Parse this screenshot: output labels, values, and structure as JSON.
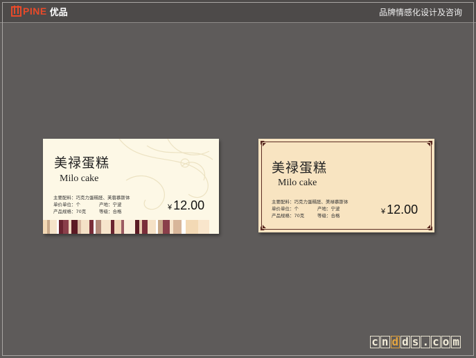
{
  "header": {
    "logo_text": "PINE",
    "logo_cn": "优品",
    "tagline": "品牌情感化设计及咨询"
  },
  "cards": [
    {
      "title_cn": "美禄蛋糕",
      "title_en": "Milo cake",
      "rows": [
        {
          "a": "主要配料：巧克力蛋糕胚、芙蓉慕斯体",
          "b": ""
        },
        {
          "a": "单价单位：个",
          "b": "产地：宁波"
        },
        {
          "a": "产品规格：70克",
          "b": "等级：合格"
        }
      ],
      "currency": "¥",
      "price": "12.00"
    },
    {
      "title_cn": "美禄蛋糕",
      "title_en": "Milo cake",
      "rows": [
        {
          "a": "主要配料：巧克力蛋糕胚、美禄慕斯体",
          "b": ""
        },
        {
          "a": "单价单位：个",
          "b": "产地：宁波"
        },
        {
          "a": "产品规格：70克",
          "b": "等级：合格"
        }
      ],
      "currency": "¥",
      "price": "12.00"
    }
  ],
  "watermark": {
    "letters": [
      "c",
      "n",
      "d",
      "d",
      "s",
      ".",
      "c",
      "o",
      "m"
    ]
  },
  "colors": {
    "background": "#5e5b5a",
    "logo": "#e84a2a",
    "card1": "#fdf8e6",
    "card2": "#f8e4c1",
    "card2_border": "#5b2b22"
  }
}
